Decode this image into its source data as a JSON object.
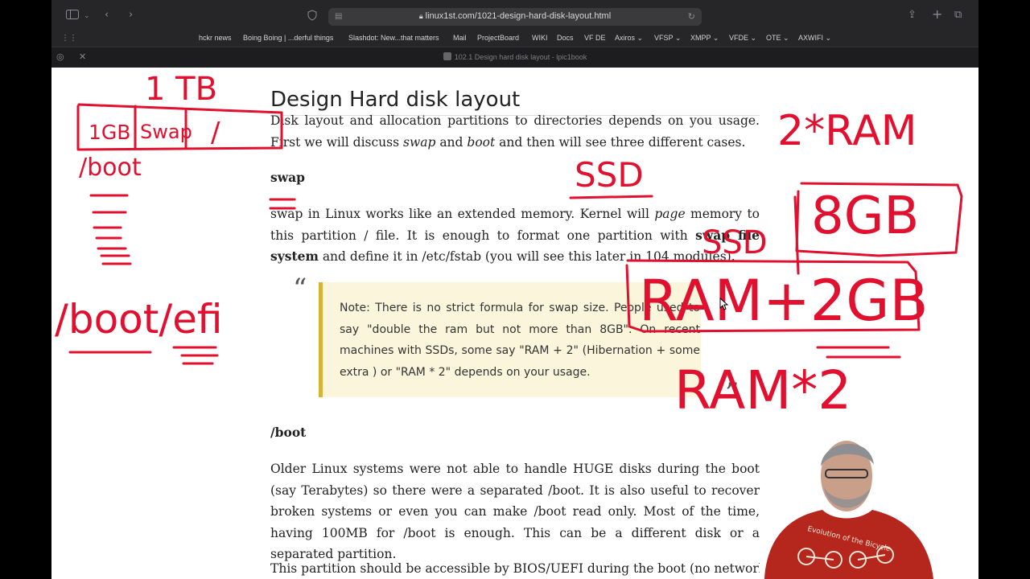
{
  "browser": {
    "url": "linux1st.com/1021-design-hard-disk-layout.html",
    "tab_title": "102.1 Design hard disk layout - lpic1book",
    "bookmarks": [
      "hckr news",
      "Boing Boing | ...derful things",
      "Slashdot: New...that matters",
      "Mail",
      "ProjectBoard",
      "WIKI",
      "Docs",
      "VF DE",
      "Axiros ⌄",
      "VFSP ⌄",
      "XMPP ⌄",
      "VFDE ⌄",
      "OTE ⌄",
      "AXWIFI ⌄"
    ],
    "icons": [
      "sidebar-icon",
      "chevron-down-icon",
      "back-icon",
      "forward-icon",
      "shield-icon",
      "reader-icon",
      "lock-icon",
      "reload-icon",
      "share-icon",
      "new-tab-icon",
      "tab-overview-icon",
      "grid-icon",
      "extension-icon",
      "tools-icon"
    ]
  },
  "article": {
    "title": "Design Hard disk layout",
    "intro": {
      "p1": "Disk layout and allocation partitions to directories depends on you usage. First we will discuss ",
      "em1": "swap",
      "p2": " and ",
      "em2": "boot",
      "p3": " and then will see three different cases."
    },
    "swap_heading": "swap",
    "swap_para": {
      "p1": "swap in Linux works like an extended memory. Kernel will ",
      "em1": "page",
      "p2": " memory to this partition / file. It is enough to format one partition with ",
      "strong1": "swap file system",
      "p3": " and define it in /etc/fstab (you will see this later in 104 modules)."
    },
    "note": "Note: There is no strict formula for swap size. People used to say \"double the ram but not more than 8GB\". On recent machines with SSDs, some say \"RAM + 2\" (Hibernation + some extra ) or \"RAM * 2\" depends on your usage.",
    "boot_heading": "/boot",
    "boot_para": "Older Linux systems were not able to handle HUGE disks during the boot (say Terabytes) so there were a separated /boot. It is also useful to recover broken systems or even you can make /boot read only. Most of the time, having 100MB for /boot is enough. This can be a different disk or a separated partition.",
    "bios_para": "This partition should be accessible by BIOS/UEFI during the boot (no network"
  },
  "annotations": {
    "disk_size": "1 TB",
    "seg_boot": "1GB",
    "seg_swap": "Swap",
    "seg_root": "/",
    "boot_label": "/boot",
    "bootefi_label": "/boot/efi",
    "two_ram": "2*RAM",
    "ssd1": "SSD",
    "ssd2": "SSD",
    "eight_gb": "8GB",
    "ram_plus": "RAM+2GB",
    "ram_times": "RAM*2",
    "ink_color": "#e0102e"
  },
  "presenter": {
    "shirt_text": "Evolution of the Bicycle",
    "shirt_color": "#b5271d"
  }
}
